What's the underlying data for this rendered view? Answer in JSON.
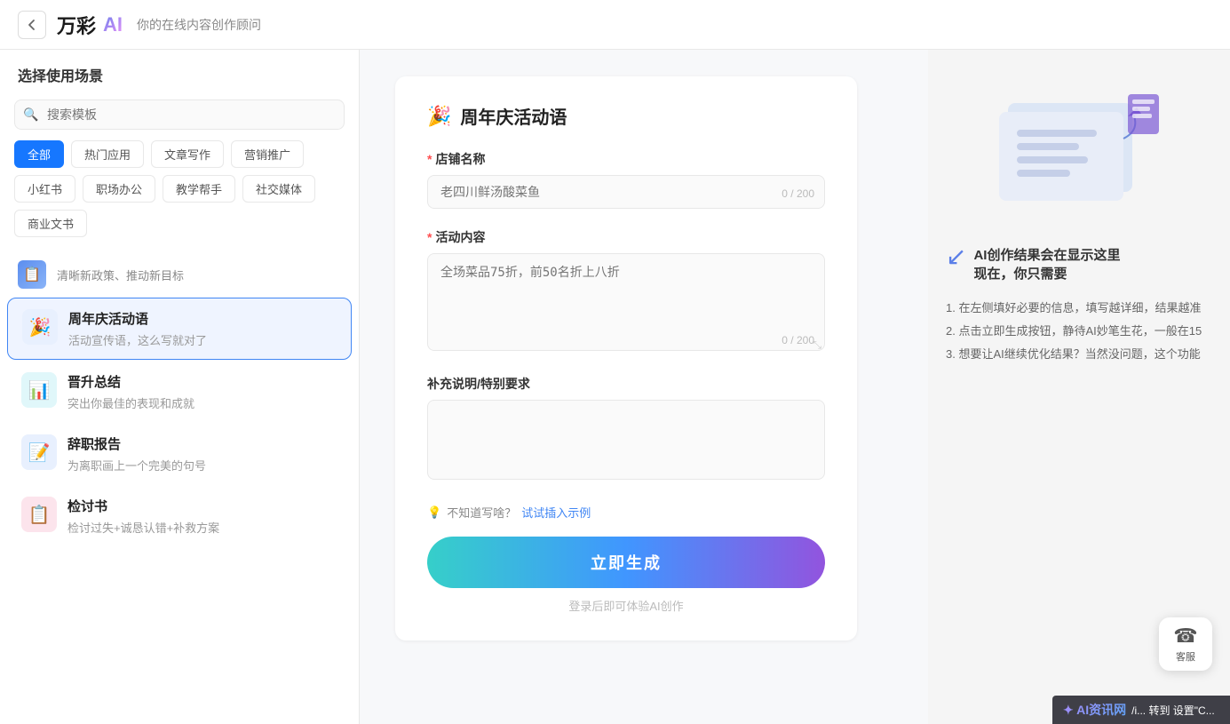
{
  "header": {
    "back_label": "‹",
    "logo_text": "万彩",
    "logo_ai": "AI",
    "subtitle": "你的在线内容创作顾问"
  },
  "sidebar": {
    "title": "选择使用场景",
    "search_placeholder": "搜索模板",
    "tags": [
      {
        "label": "全部",
        "active": true
      },
      {
        "label": "热门应用",
        "active": false
      },
      {
        "label": "文章写作",
        "active": false
      },
      {
        "label": "营销推广",
        "active": false
      },
      {
        "label": "小红书",
        "active": false
      },
      {
        "label": "职场办公",
        "active": false
      },
      {
        "label": "教学帮手",
        "active": false
      },
      {
        "label": "社交媒体",
        "active": false
      },
      {
        "label": "商业文书",
        "active": false
      }
    ],
    "policy_item": {
      "icon": "📋",
      "text": "清晰新政策、推动新目标"
    },
    "templates": [
      {
        "icon": "🎉",
        "icon_style": "blue",
        "name": "周年庆活动语",
        "desc": "活动宣传语，这么写就对了",
        "active": true
      },
      {
        "icon": "📊",
        "icon_style": "cyan",
        "name": "晋升总结",
        "desc": "突出你最佳的表现和成就",
        "active": false
      },
      {
        "icon": "📝",
        "icon_style": "blue",
        "name": "辞职报告",
        "desc": "为离职画上一个完美的句号",
        "active": false
      },
      {
        "icon": "📋",
        "icon_style": "red",
        "name": "检讨书",
        "desc": "检讨过失+诚恳认错+补救方案",
        "active": false
      }
    ]
  },
  "form": {
    "title": "周年庆活动语",
    "title_icon": "🎉",
    "fields": [
      {
        "id": "shop_name",
        "label": "店铺名称",
        "required": true,
        "placeholder": "老四川鲜汤酸菜鱼",
        "type": "input",
        "max": 200,
        "current": "0 / 200"
      },
      {
        "id": "activity_content",
        "label": "活动内容",
        "required": true,
        "placeholder": "全场菜品75折，前50名折上八折",
        "type": "textarea",
        "max": 200,
        "current": "0 / 200"
      },
      {
        "id": "extra_notes",
        "label": "补充说明/特别要求",
        "required": false,
        "placeholder": "",
        "type": "textarea",
        "max": null,
        "current": null
      }
    ],
    "hint_icon": "💡",
    "hint_text": "不知道写啥？试试插入示例",
    "generate_btn": "立即生成",
    "login_hint": "登录后即可体验AI创作"
  },
  "right_panel": {
    "ai_result_line1": "AI创作结果会在显示这里",
    "ai_result_line2": "现在，你只需要",
    "steps": [
      "1. 在左侧填好必要的信息，填写越详细，结果越准",
      "2. 点击立即生成按钮，静待AI妙笔生花，一般在15",
      "3. 想要让AI继续优化结果？当然没问题，这个功能"
    ]
  },
  "cs": {
    "icon": "☎",
    "label": "客服"
  },
  "bottom_bar": {
    "logo": "AI资讯网",
    "text": "/i...",
    "suffix": "转到 设置\"C..."
  }
}
